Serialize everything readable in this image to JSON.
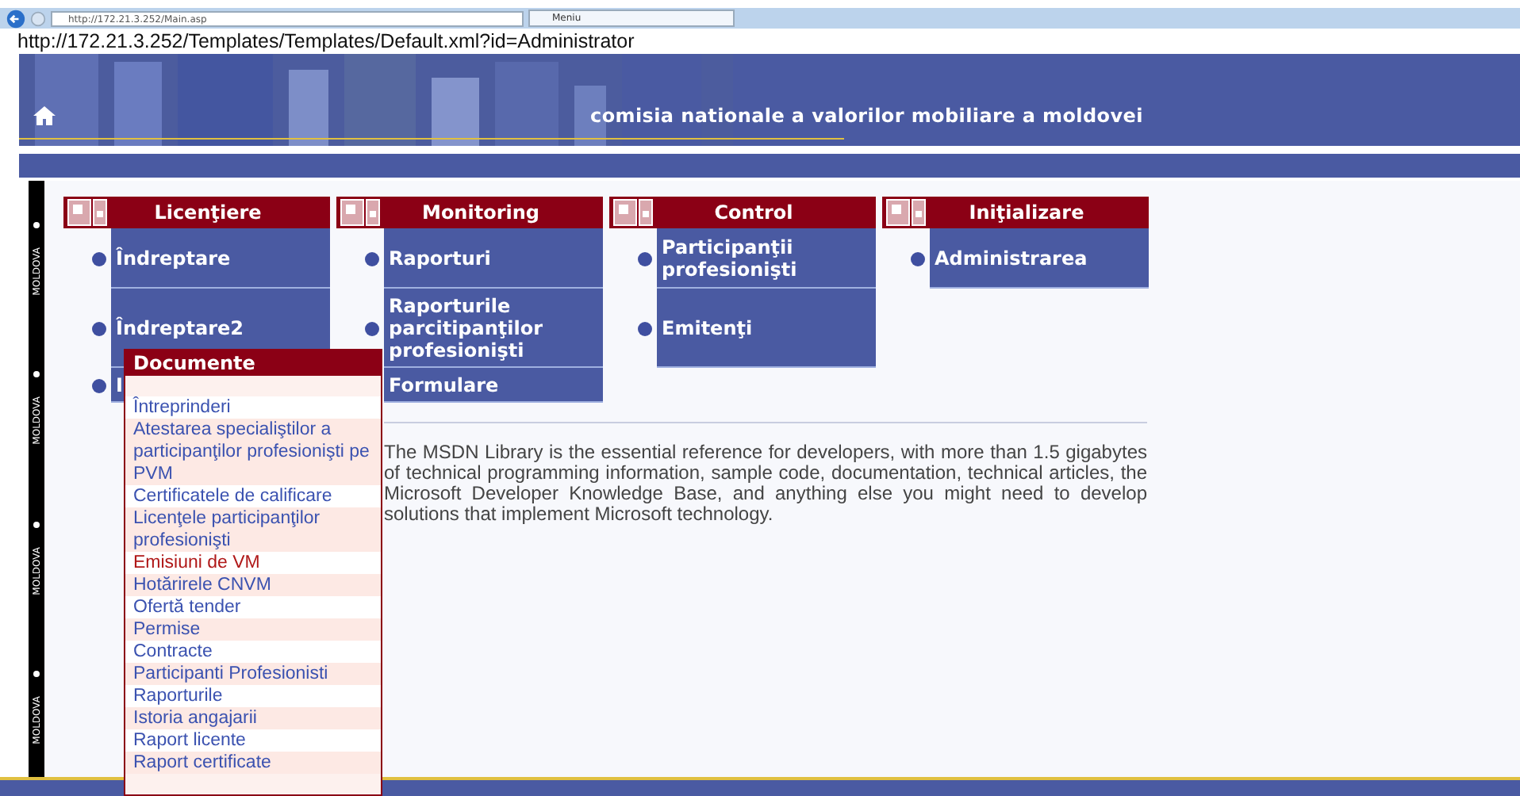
{
  "browser": {
    "address": "http://172.21.3.252/Main.asp",
    "tab": "Meniu"
  },
  "url_line": "http://172.21.3.252/Templates/Templates/Default.xml?id=Administrator",
  "banner": {
    "title": "comisia nationale a valorilor mobiliare a moldovei"
  },
  "side_strip": [
    "MOLDOVA",
    "MOLDOVA",
    "MOLDOVA",
    "MOLDOVA"
  ],
  "menus": [
    {
      "title": "Licenţiere",
      "items": [
        "Îndreptare",
        "Îndreptare2",
        "I"
      ]
    },
    {
      "title": "Monitoring",
      "items": [
        "Raporturi",
        "Raporturile parcitipanţilor profesionişti",
        "Formulare"
      ]
    },
    {
      "title": "Control",
      "items": [
        "Participanţii profesionişti",
        "Emitenţi"
      ]
    },
    {
      "title": "Iniţializare",
      "items": [
        "Administrarea"
      ]
    }
  ],
  "popup": {
    "title": "Documente",
    "items": [
      {
        "label": "Întreprinderi",
        "selected": false
      },
      {
        "label": "Atestarea specialiştilor a participanţilor profesionişti pe PVM",
        "selected": false
      },
      {
        "label": "Certificatele de calificare",
        "selected": false
      },
      {
        "label": "Licenţele participanţilor profesionişti",
        "selected": false
      },
      {
        "label": "Emisiuni de VM",
        "selected": true
      },
      {
        "label": "Hotărirele CNVM",
        "selected": false
      },
      {
        "label": "Ofertă tender",
        "selected": false
      },
      {
        "label": "Permise",
        "selected": false
      },
      {
        "label": "Contracte",
        "selected": false
      },
      {
        "label": "Participanti Profesionisti",
        "selected": false
      },
      {
        "label": "Raporturile",
        "selected": false
      },
      {
        "label": "Istoria angajarii",
        "selected": false
      },
      {
        "label": "Raport licente",
        "selected": false
      },
      {
        "label": "Raport certificate",
        "selected": false
      }
    ]
  },
  "description": "The MSDN Library is the essential reference for developers, with more than 1.5 gigabytes of technical programming information, sample code, documentation, technical articles, the Microsoft Developer Knowledge Base, and anything else you might need to develop solutions that implement Microsoft technology."
}
